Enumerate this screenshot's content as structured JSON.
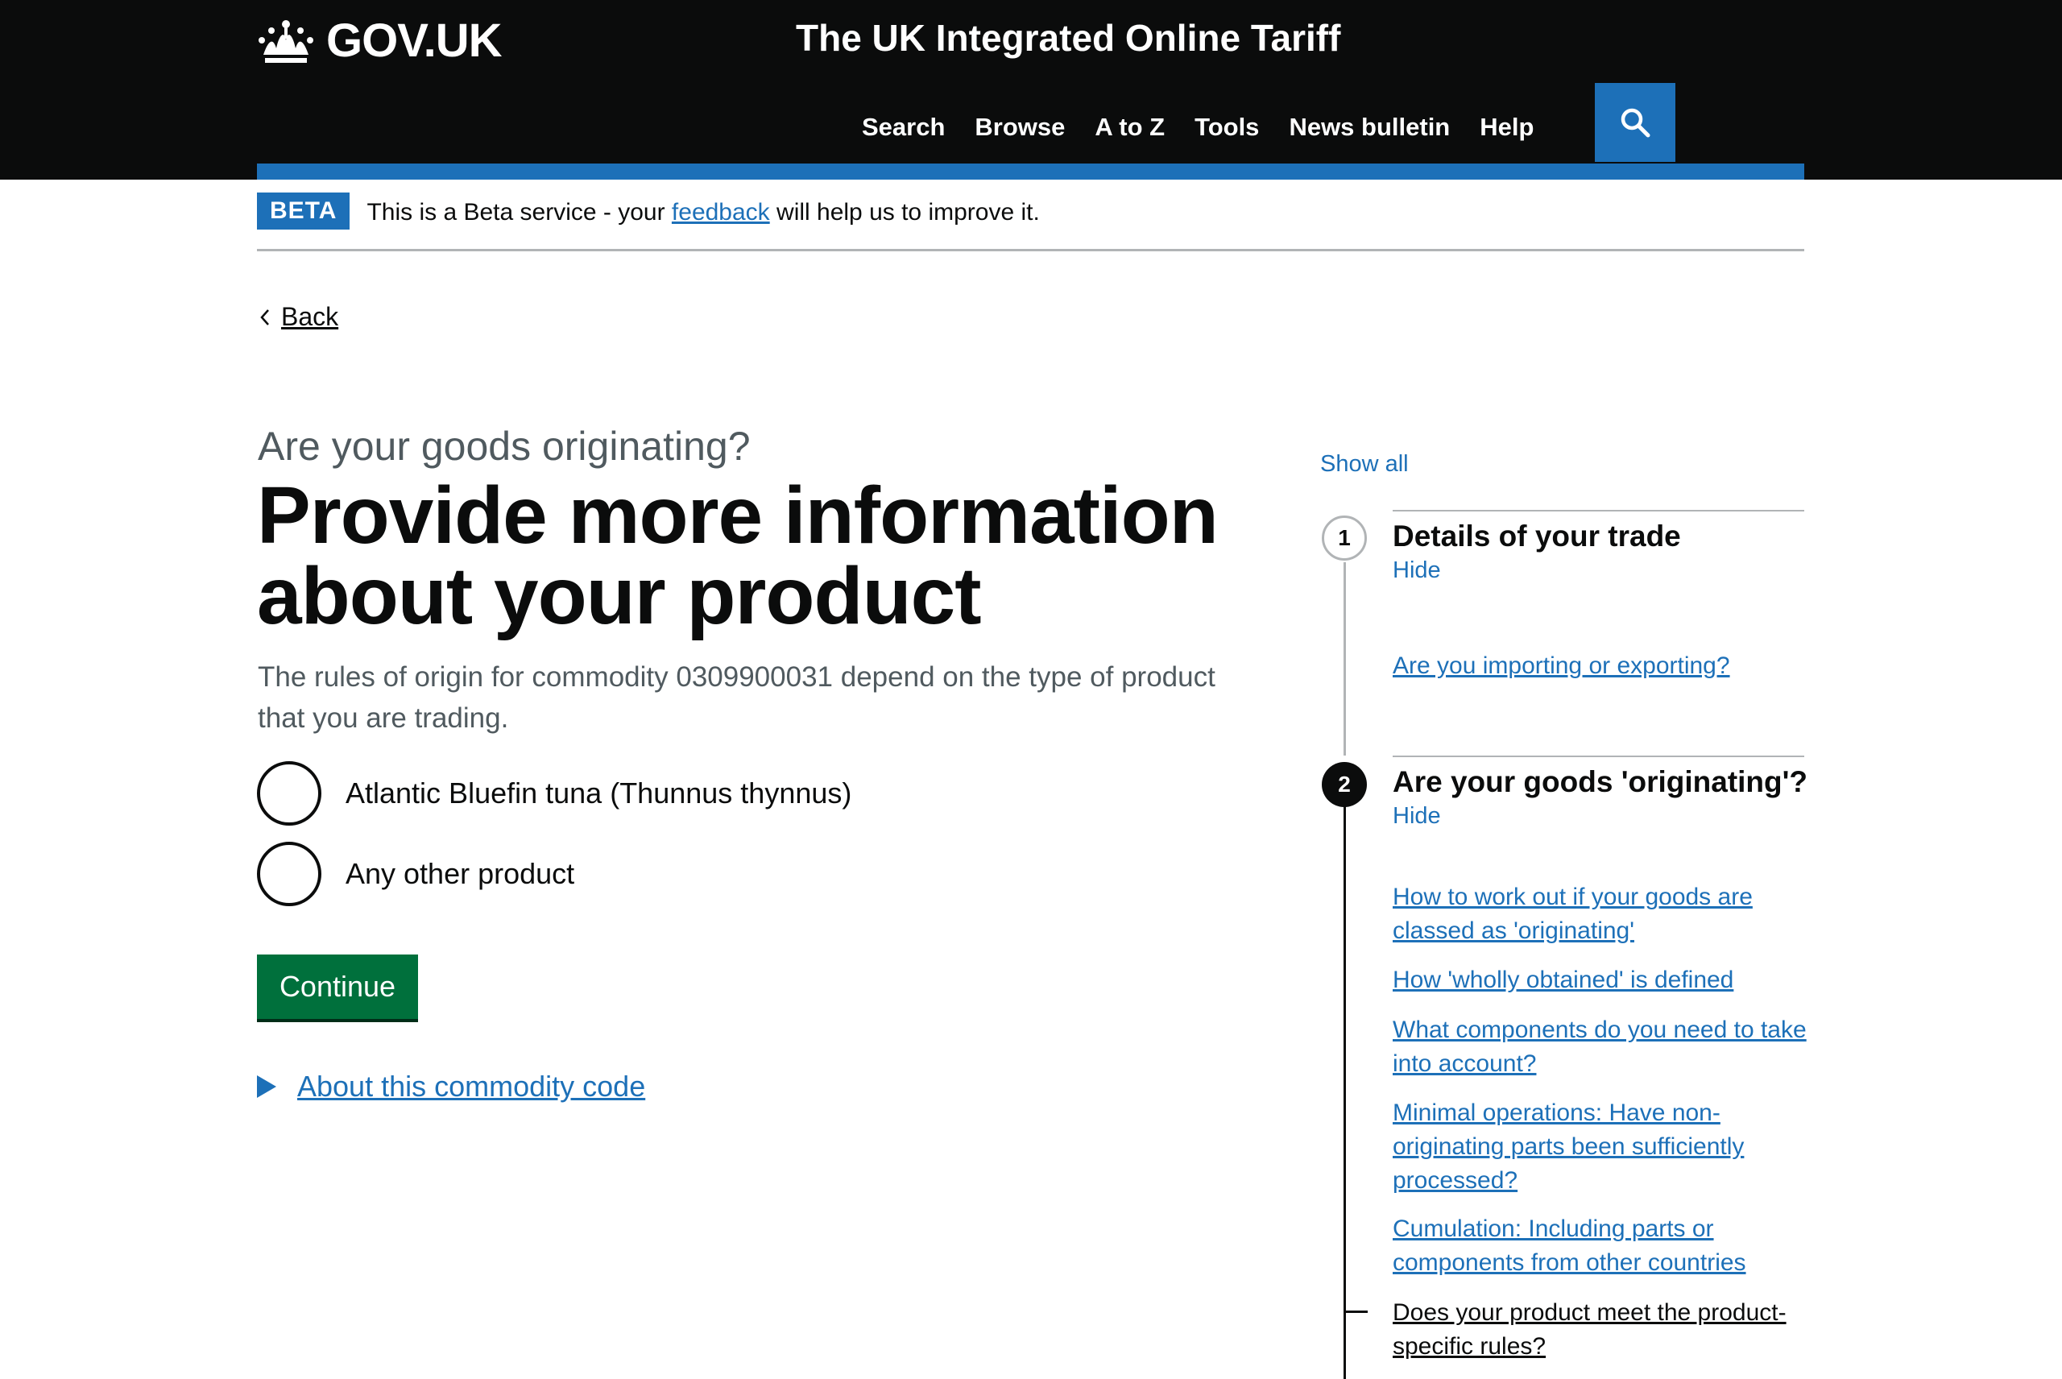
{
  "header": {
    "logo_text": "GOV.UK",
    "service_title": "The UK Integrated Online Tariff",
    "nav": [
      "Search",
      "Browse",
      "A to Z",
      "Tools",
      "News bulletin",
      "Help"
    ]
  },
  "phase_banner": {
    "tag": "BETA",
    "text_before": "This is a Beta service - your ",
    "link": "feedback",
    "text_after": " will help us to improve it."
  },
  "back_link": "Back",
  "main": {
    "caption": "Are your goods originating?",
    "heading": "Provide more information about your product",
    "hint": "The rules of origin for commodity 0309900031 depend on the type of product that you are trading.",
    "options": [
      "Atlantic Bluefin tuna (Thunnus thynnus)",
      "Any other product"
    ],
    "continue_label": "Continue",
    "details_summary": "About this commodity code"
  },
  "step_nav": {
    "show_all": "Show all",
    "steps": [
      {
        "number": "1",
        "title": "Details of your trade",
        "toggle": "Hide",
        "links": [
          "Are you importing or exporting?"
        ]
      },
      {
        "number": "2",
        "title": "Are your goods 'originating'?",
        "toggle": "Hide",
        "links": [
          "How to work out if your goods are classed as 'originating'",
          "How 'wholly obtained' is defined",
          "What components do you need to take into account?",
          "Minimal operations: Have non-originating parts been sufficiently processed?",
          "Cumulation: Including parts or components from other countries",
          "Does your product meet the product-specific rules?"
        ]
      }
    ]
  },
  "colors": {
    "header_bg": "#0b0c0c",
    "brand_blue": "#1d70b8",
    "button_green": "#00703c",
    "secondary_text": "#505a5f"
  }
}
